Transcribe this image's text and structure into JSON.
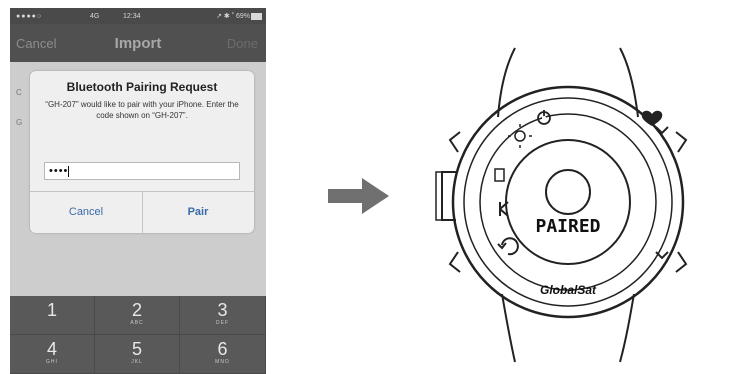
{
  "phone": {
    "status": {
      "signal": "●●●●○",
      "network": "4G",
      "time": "12:34",
      "battery_text": "↗ ✱ ˚ 69%"
    },
    "nav": {
      "left": "Cancel",
      "title": "Import",
      "right": "Done"
    },
    "row_letters": [
      "C",
      "G"
    ],
    "dialog": {
      "title": "Bluetooth Pairing Request",
      "message": "“GH-207” would like to pair with your iPhone. Enter the code shown on “GH-207”.",
      "code_value": "••••",
      "cancel_label": "Cancel",
      "pair_label": "Pair"
    },
    "keypad": [
      {
        "num": "1",
        "letters": ""
      },
      {
        "num": "2",
        "letters": "ABC"
      },
      {
        "num": "3",
        "letters": "DEF"
      },
      {
        "num": "4",
        "letters": "GHI"
      },
      {
        "num": "5",
        "letters": "JKL"
      },
      {
        "num": "6",
        "letters": "MNO"
      }
    ]
  },
  "watch": {
    "display_text": "PAIRED",
    "brand": "GlobalSat"
  },
  "colors": {
    "phone_bg": "#cfcfcf",
    "nav_bg": "#505050",
    "dialog_bg": "#efefef",
    "button_text": "#3a6aa8",
    "keypad_bg": "#595959",
    "arrow": "#707070"
  }
}
